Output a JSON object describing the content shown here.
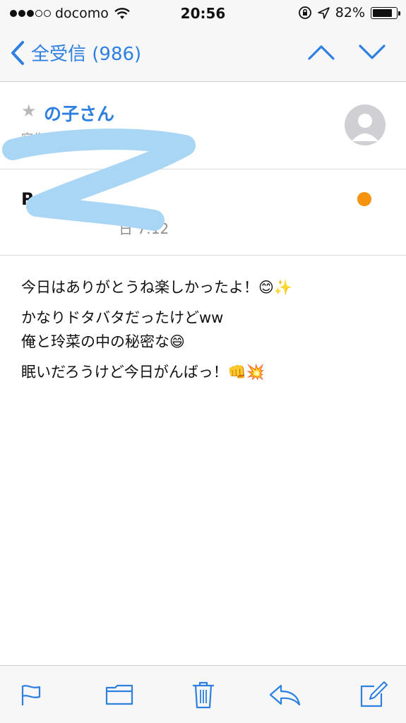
{
  "status_bar": {
    "carrier": "docomo",
    "time": "20:56",
    "battery": "82%",
    "signal_bars_filled": 3,
    "signal_bars_total": 5
  },
  "nav": {
    "back_label": "全受信 (986)"
  },
  "message": {
    "sender": "の子さん",
    "recipient_prefix": "宛先：斎藤玲菜",
    "details_link": "詳細",
    "subject_fragment": "R",
    "date_fragment": "日 7:12",
    "body_paragraphs": [
      [
        "今日はありがとうね楽しかったよ！😊✨"
      ],
      [
        "かなりドタバタだったけどww",
        "俺と玲菜の中の秘密な😄"
      ],
      [
        "眠いだろうけど今日がんばっ！👊💥"
      ]
    ]
  },
  "icons": {
    "back": "chevron-left-icon",
    "prev": "chevron-up-icon",
    "next": "chevron-down-icon",
    "flag": "flag-icon",
    "folder": "folder-icon",
    "trash": "trash-icon",
    "reply": "reply-icon",
    "compose": "compose-icon"
  },
  "colors": {
    "accent": "#2d7fe0",
    "unread": "#f5930f",
    "scribble": "#a9d6f5"
  }
}
